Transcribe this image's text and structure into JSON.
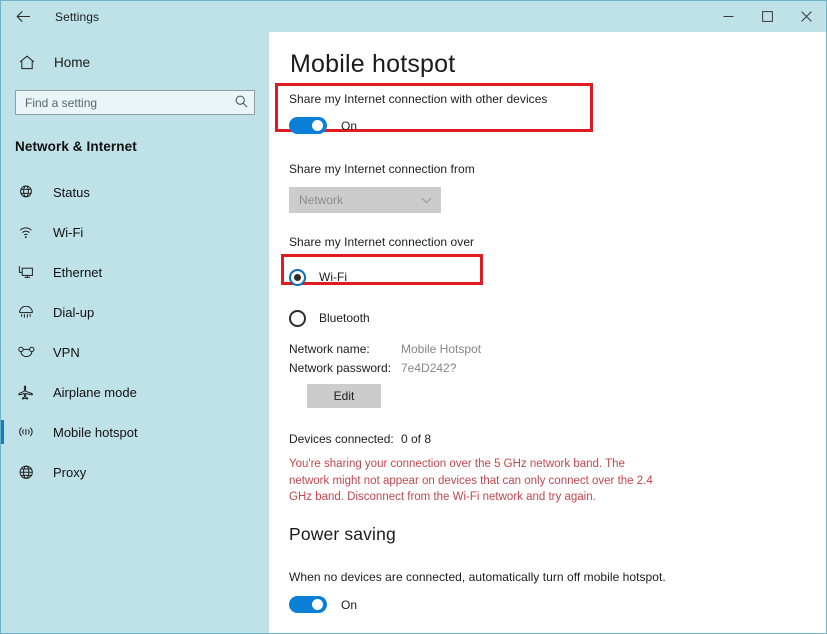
{
  "titlebar": {
    "back_icon": "back-arrow-icon",
    "title": "Settings",
    "minimize_icon": "minimize-icon",
    "maximize_icon": "maximize-icon",
    "close_icon": "close-icon"
  },
  "sidebar": {
    "home_label": "Home",
    "home_icon": "home-icon",
    "search": {
      "placeholder": "Find a setting",
      "value": "",
      "icon": "search-icon"
    },
    "category_title": "Network & Internet",
    "items": [
      {
        "label": "Status",
        "icon": "globe-status-icon",
        "selected": false
      },
      {
        "label": "Wi-Fi",
        "icon": "wifi-icon",
        "selected": false
      },
      {
        "label": "Ethernet",
        "icon": "ethernet-icon",
        "selected": false
      },
      {
        "label": "Dial-up",
        "icon": "dialup-icon",
        "selected": false
      },
      {
        "label": "VPN",
        "icon": "vpn-icon",
        "selected": false
      },
      {
        "label": "Airplane mode",
        "icon": "airplane-icon",
        "selected": false
      },
      {
        "label": "Mobile hotspot",
        "icon": "mobile-hotspot-icon",
        "selected": true
      },
      {
        "label": "Proxy",
        "icon": "proxy-globe-icon",
        "selected": false
      }
    ]
  },
  "main": {
    "page_title": "Mobile hotspot",
    "share_section": {
      "label": "Share my Internet connection with other devices",
      "toggle_state": "On",
      "toggle_on": true
    },
    "share_from": {
      "label": "Share my Internet connection from",
      "selected_value": "Network",
      "disabled": true,
      "chevron_icon": "chevron-down-icon"
    },
    "share_over": {
      "label": "Share my Internet connection over",
      "options": [
        {
          "label": "Wi-Fi",
          "checked": true
        },
        {
          "label": "Bluetooth",
          "checked": false
        }
      ]
    },
    "network_info": [
      {
        "key": "Network name:",
        "value": "Mobile Hotspot"
      },
      {
        "key": "Network password:",
        "value": "7e4D242?"
      }
    ],
    "edit_button": "Edit",
    "devices": {
      "key": "Devices connected:",
      "value": "0 of 8"
    },
    "warning": "You're sharing your connection over the 5 GHz network band. The network might not appear on devices that can only connect over the 2.4 GHz band. Disconnect from the Wi-Fi network and try again.",
    "power_saving": {
      "heading": "Power saving",
      "description": "When no devices are connected, automatically turn off mobile hotspot.",
      "toggle_state": "On",
      "toggle_on": true
    }
  },
  "colors": {
    "accent_blue": "#0a7fd6",
    "sidebar_bg": "#bfe2e8",
    "highlight_red": "#e01b22",
    "warning_red": "#c8454a",
    "disabled_grey": "#cccccc"
  }
}
